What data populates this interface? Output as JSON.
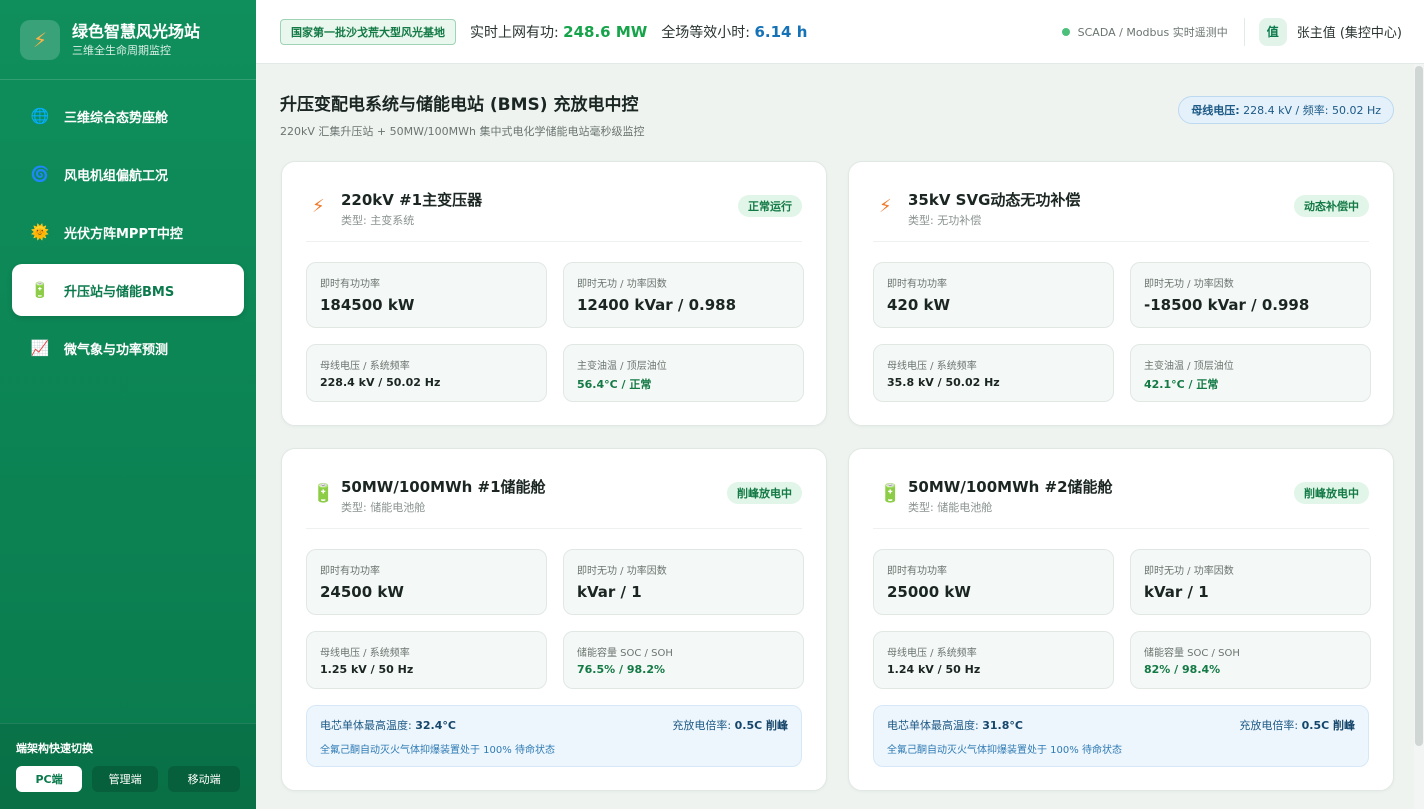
{
  "brand": {
    "title": "绿色智慧风光场站",
    "subtitle": "三维全生命周期监控",
    "logo_icon": "bolt-icon"
  },
  "nav": [
    {
      "label": "三维综合态势座舱",
      "icon": "globe-icon",
      "glyph": "🌐",
      "active": false
    },
    {
      "label": "风电机组偏航工况",
      "icon": "cyclone-icon",
      "glyph": "🌀",
      "active": false
    },
    {
      "label": "光伏方阵MPPT中控",
      "icon": "sun-icon",
      "glyph": "🌞",
      "active": false
    },
    {
      "label": "升压站与储能BMS",
      "icon": "battery-icon",
      "glyph": "🔋",
      "active": true
    },
    {
      "label": "微气象与功率预测",
      "icon": "chart-icon",
      "glyph": "📈",
      "active": false
    }
  ],
  "footer": {
    "label": "端架构快速切换",
    "buttons": [
      "PC端",
      "管理端",
      "移动端"
    ]
  },
  "topbar": {
    "badge": "国家第一批沙戈荒大型风光基地",
    "power_label": "实时上网有功:",
    "power_value": "248.6 MW",
    "hours_label": "全场等效小时:",
    "hours_value": "6.14 h",
    "scada": "SCADA / Modbus 实时遥测中",
    "avatar": "值",
    "user": "张主值 (集控中心)"
  },
  "page": {
    "title": "升压变配电系统与储能电站 (BMS) 充放电中控",
    "subtitle": "220kV 汇集升压站 + 50MW/100MWh 集中式电化学储能电站毫秒级监控",
    "bus_badge_label": "母线电压:",
    "bus_badge_value": "228.4 kV / 频率: 50.02 Hz"
  },
  "cards": [
    {
      "title": "220kV #1主变压器",
      "type": "类型: 主变系统",
      "status": "正常运行",
      "icon": "bolt-icon",
      "active_label": "即时有功功率",
      "active_value": "184500 kW",
      "reactive_label": "即时无功 / 功率因数",
      "reactive_value": "12400 kVar / 0.988",
      "bus_label": "母线电压 / 系统频率",
      "bus_value": "228.4 kV / 50.02 Hz",
      "extra_label": "主变油温 / 顶层油位",
      "extra_value": "56.4°C / 正常"
    },
    {
      "title": "35kV SVG动态无功补偿",
      "type": "类型: 无功补偿",
      "status": "动态补偿中",
      "icon": "bolt-icon",
      "active_label": "即时有功功率",
      "active_value": "420 kW",
      "reactive_label": "即时无功 / 功率因数",
      "reactive_value": "-18500 kVar / 0.998",
      "bus_label": "母线电压 / 系统频率",
      "bus_value": "35.8 kV / 50.02 Hz",
      "extra_label": "主变油温 / 顶层油位",
      "extra_value": "42.1°C / 正常"
    },
    {
      "title": "50MW/100MWh #1储能舱",
      "type": "类型: 储能电池舱",
      "status": "削峰放电中",
      "icon": "battery-icon",
      "active_label": "即时有功功率",
      "active_value": "24500 kW",
      "reactive_label": "即时无功 / 功率因数",
      "reactive_value": "kVar / 1",
      "bus_label": "母线电压 / 系统频率",
      "bus_value": "1.25 kV / 50 Hz",
      "extra_label": "储能容量 SOC / SOH",
      "extra_value": "76.5% / 98.2%",
      "note": {
        "temp_label": "电芯单体最高温度:",
        "temp_value": "32.4°C",
        "rate_label": "充放电倍率:",
        "rate_value": "0.5C 削峰",
        "fire": "全氟己酮自动灭火气体抑爆装置处于 100% 待命状态"
      }
    },
    {
      "title": "50MW/100MWh #2储能舱",
      "type": "类型: 储能电池舱",
      "status": "削峰放电中",
      "icon": "battery-icon",
      "active_label": "即时有功功率",
      "active_value": "25000 kW",
      "reactive_label": "即时无功 / 功率因数",
      "reactive_value": "kVar / 1",
      "bus_label": "母线电压 / 系统频率",
      "bus_value": "1.24 kV / 50 Hz",
      "extra_label": "储能容量 SOC / SOH",
      "extra_value": "82% / 98.4%",
      "note": {
        "temp_label": "电芯单体最高温度:",
        "temp_value": "31.8°C",
        "rate_label": "充放电倍率:",
        "rate_value": "0.5C 削峰",
        "fire": "全氟己酮自动灭火气体抑爆装置处于 100% 待命状态"
      }
    }
  ]
}
